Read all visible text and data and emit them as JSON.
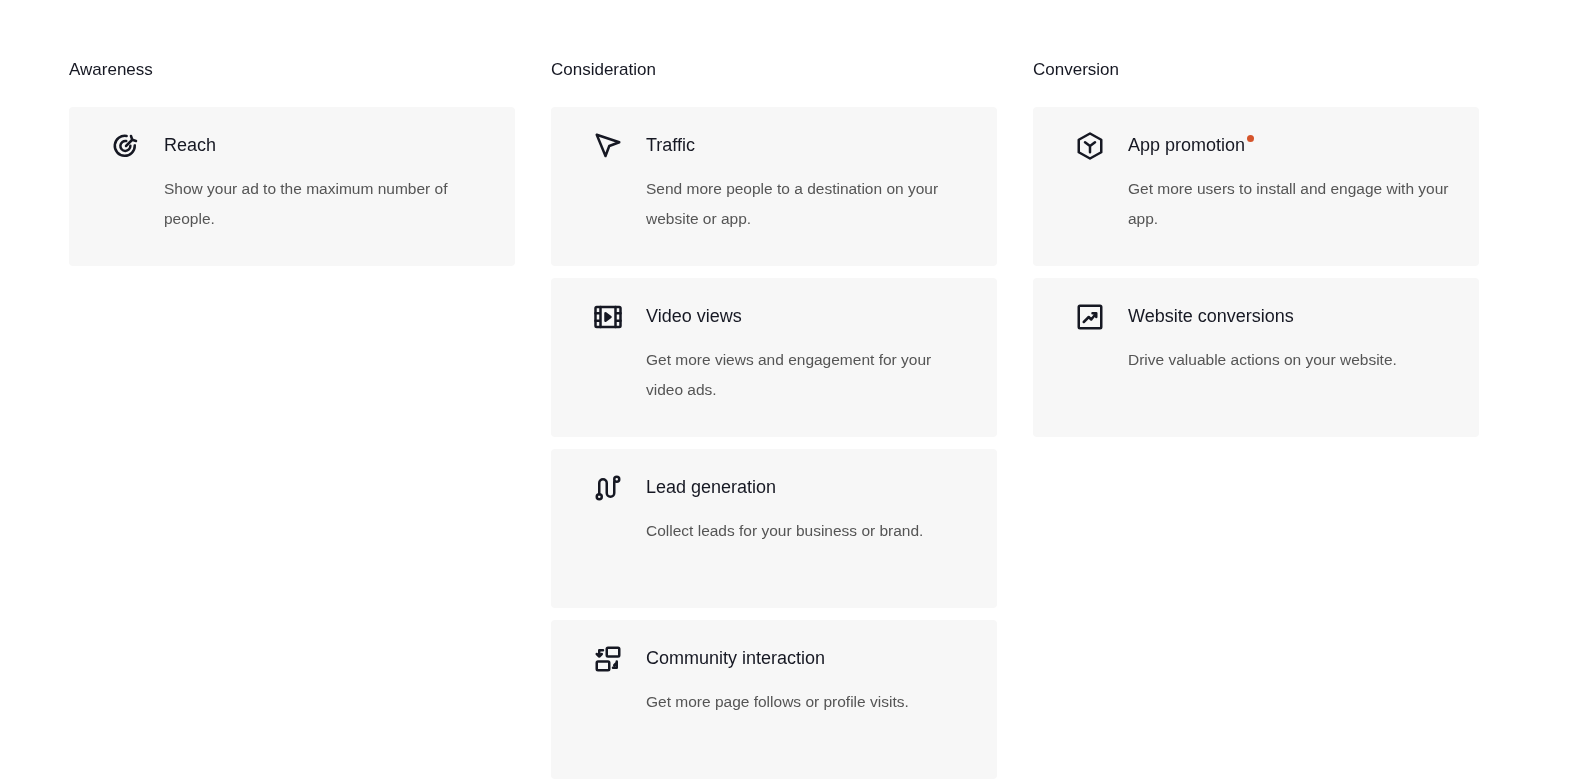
{
  "columns": [
    {
      "title": "Awareness",
      "options": [
        {
          "kind": "target",
          "title": "Reach",
          "description": "Show your ad to the maximum number of people.",
          "new": false
        }
      ]
    },
    {
      "title": "Consideration",
      "options": [
        {
          "kind": "cursor",
          "title": "Traffic",
          "description": "Send more people to a destination on your website or app.",
          "new": false
        },
        {
          "kind": "film",
          "title": "Video views",
          "description": "Get more views and engagement for your video ads.",
          "new": false
        },
        {
          "kind": "path",
          "title": "Lead generation",
          "description": "Collect leads for your business or brand.",
          "new": false
        },
        {
          "kind": "swap",
          "title": "Community interaction",
          "description": "Get more page follows or profile visits.",
          "new": false
        }
      ]
    },
    {
      "title": "Conversion",
      "options": [
        {
          "kind": "hexagon",
          "title": "App promotion",
          "description": "Get more users to install and engage with your app.",
          "new": true
        },
        {
          "kind": "chart",
          "title": "Website conversions",
          "description": "Drive valuable actions on your website.",
          "new": false
        }
      ]
    }
  ]
}
